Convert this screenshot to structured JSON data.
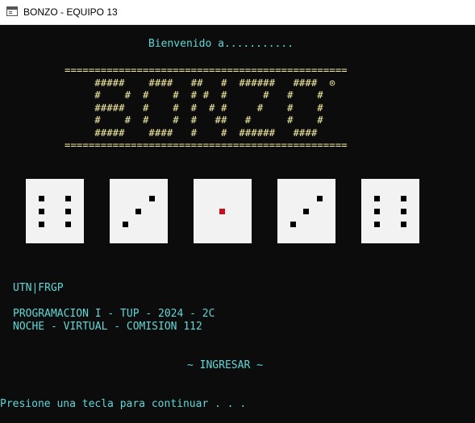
{
  "window": {
    "title": "BONZO - EQUIPO 13",
    "icon": "console-icon"
  },
  "console": {
    "welcome": "Bienvenido a...........",
    "logo_lines": [
      "===============================================",
      "     #####    ####   ##   #  ######   ####  ⊙",
      "     #    #  #    #  # #  #      #   #    #",
      "     #####   #    #  #  # #     #    #    #",
      "     #    #  #    #  #   ##   #      #    #",
      "     #####    ####   #    #  ######   ####",
      "==============================================="
    ],
    "dice": [
      {
        "value": 6
      },
      {
        "value": 3
      },
      {
        "value": 1,
        "pip_color": "#c50f1f"
      },
      {
        "value": 3
      },
      {
        "value": 6
      }
    ],
    "institution": "UTN|FRGP",
    "course_line1": "PROGRAMACION I - TUP - 2024 - 2C",
    "course_line2": "NOCHE - VIRTUAL - COMISION 112",
    "enter_option": "~ INGRESAR ~",
    "prompt": "Presione una tecla para continuar . . ."
  },
  "colors": {
    "background": "#0c0c0c",
    "cyan_text": "#61d6d6",
    "yellow_text": "#f9f1a5",
    "die_face": "#f2f2f2",
    "pip": "#000000",
    "pip_highlight": "#c50f1f"
  }
}
